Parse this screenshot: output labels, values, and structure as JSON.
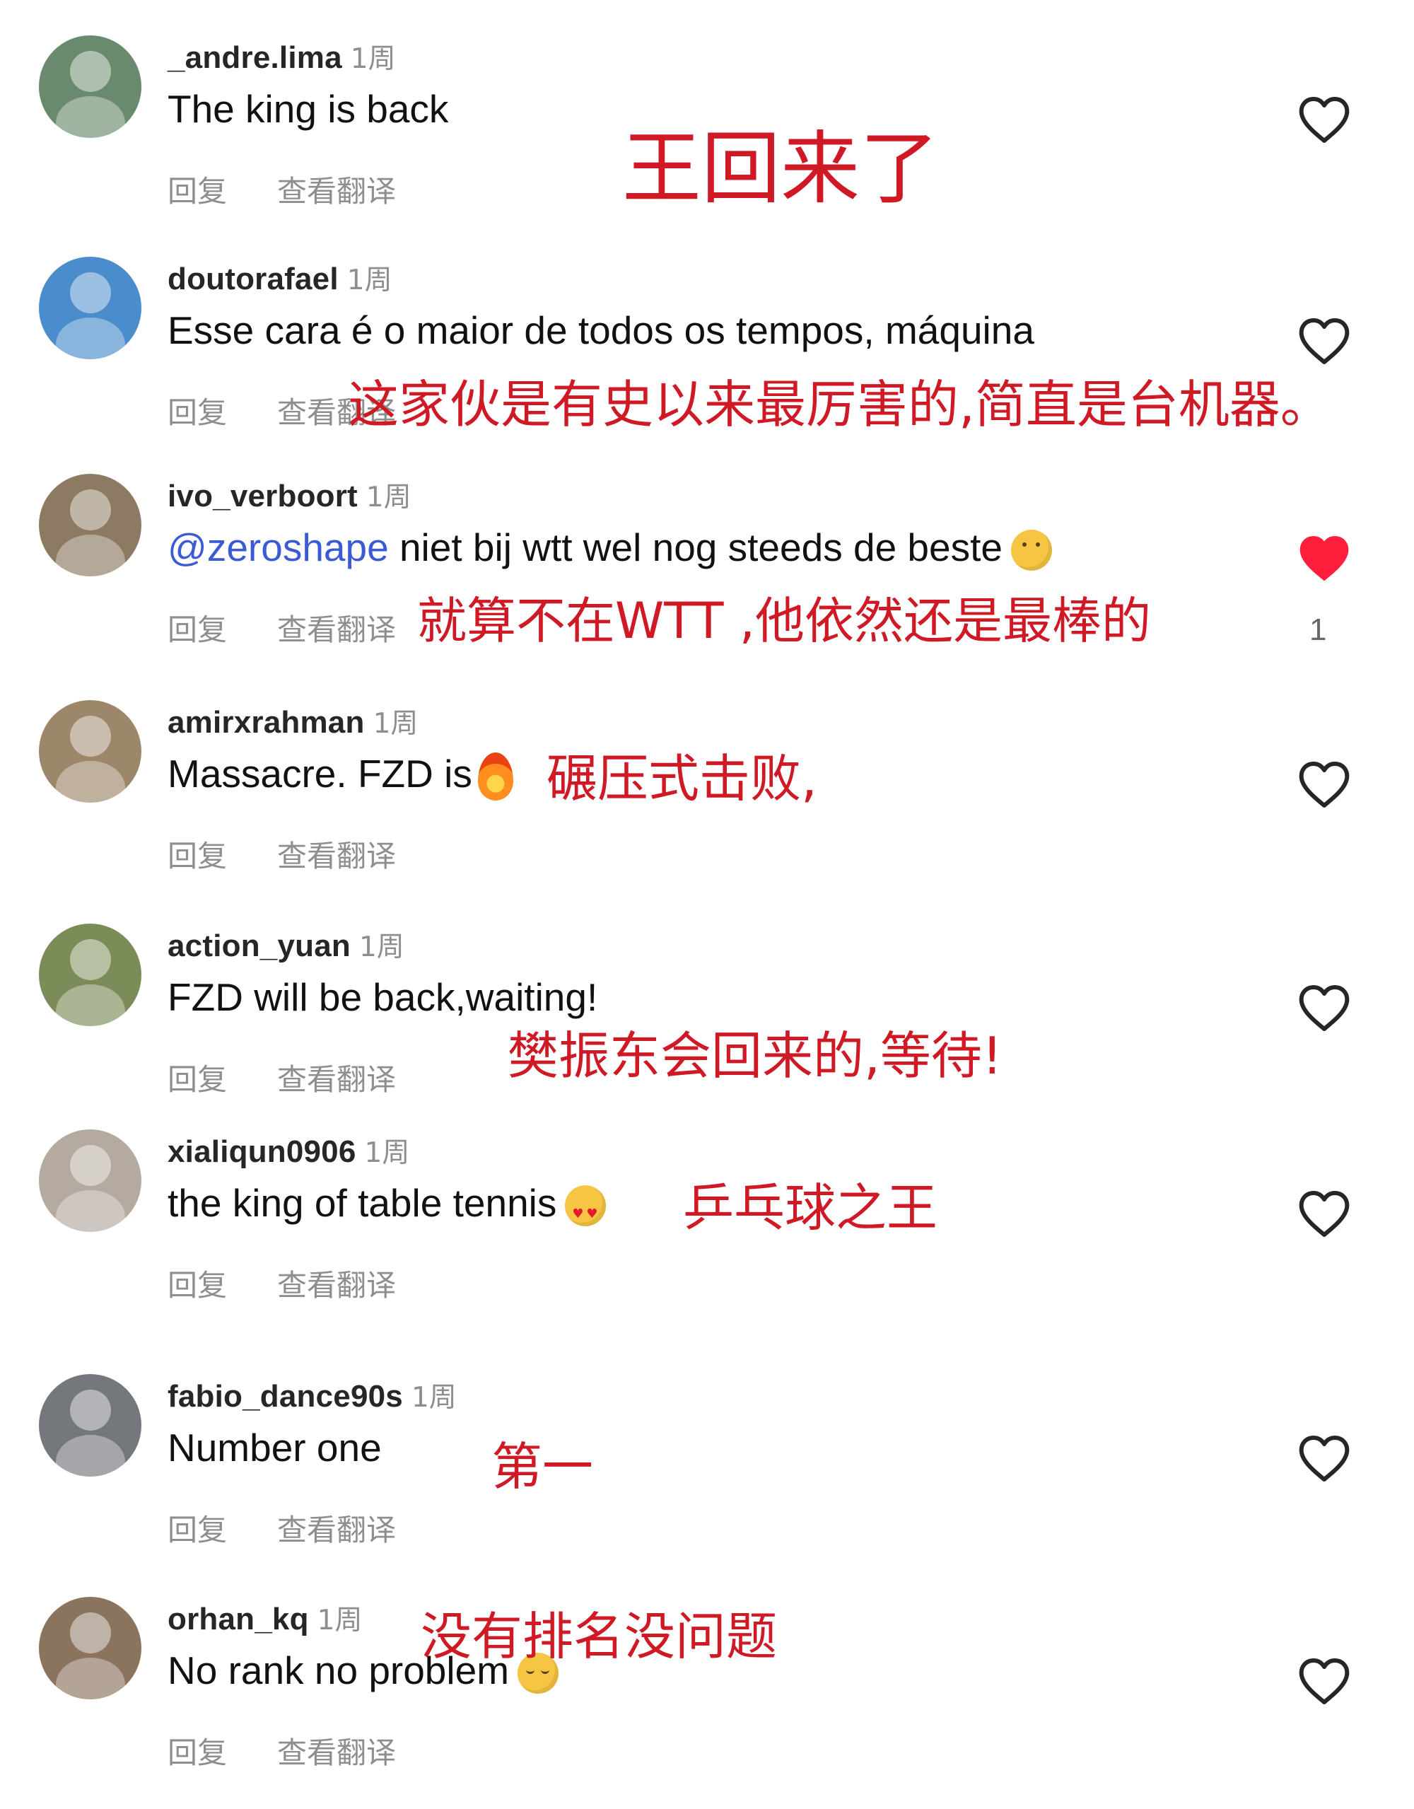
{
  "colors": {
    "background": "#ffffff",
    "username": "#262626",
    "time": "#8e8e8e",
    "text": "#111111",
    "mention": "#3b5bd5",
    "actions": "#8e8e8e",
    "heart_outline": "#262626",
    "heart_filled": "#ff1f3d",
    "annotation": "#cf1a26"
  },
  "icons": {
    "heart_outline": "heart-outline-icon",
    "heart_filled": "heart-filled-icon",
    "cry_emoji": "crying-face-icon",
    "fire_emoji": "fire-icon",
    "heart_eyes_emoji": "heart-eyes-face-icon",
    "relieved_emoji": "relieved-face-icon"
  },
  "comments": [
    {
      "username": "_andre.lima",
      "time": "1周",
      "text": "The king is back",
      "reply": "回复",
      "translate": "查看翻译",
      "annotation": "王回来了",
      "avatar_color": "#6a8a6e"
    },
    {
      "username": "doutorafael",
      "time": "1周",
      "text": "Esse cara é o maior de todos os tempos, máquina",
      "reply": "回复",
      "translate": "查看翻译",
      "annotation": "这家伙是有史以来最厉害的,简直是台机器。",
      "avatar_color": "#4b8ccd"
    },
    {
      "username": "ivo_verboort",
      "time": "1周",
      "mention": "@zeroshape",
      "text_after_mention": " niet bij wtt wel nog steeds de beste",
      "reply": "回复",
      "translate": "查看翻译",
      "annotation": "就算不在WTT ,他依然还是最棒的",
      "likes": "1",
      "avatar_color": "#8c7a62"
    },
    {
      "username": "amirxrahman",
      "time": "1周",
      "text": "Massacre. FZD is",
      "reply": "回复",
      "translate": "查看翻译",
      "annotation": "碾压式击败,",
      "avatar_color": "#9d876b"
    },
    {
      "username": "action_yuan",
      "time": "1周",
      "text": "FZD will be back,waiting!",
      "reply": "回复",
      "translate": "查看翻译",
      "annotation": "樊振东会回来的,等待!",
      "avatar_color": "#7b8c58"
    },
    {
      "username": "xialiqun0906",
      "time": "1周",
      "text": "the king of table tennis",
      "reply": "回复",
      "translate": "查看翻译",
      "annotation": "乒乓球之王",
      "avatar_color": "#b4aaa0"
    },
    {
      "username": "fabio_dance90s",
      "time": "1周",
      "text": "Number one",
      "reply": "回复",
      "translate": "查看翻译",
      "annotation": "第一",
      "avatar_color": "#74777c"
    },
    {
      "username": "orhan_kq",
      "time": "1周",
      "text": "No rank no problem",
      "reply": "回复",
      "translate": "查看翻译",
      "annotation": "没有排名没问题",
      "avatar_color": "#8b745d"
    }
  ]
}
